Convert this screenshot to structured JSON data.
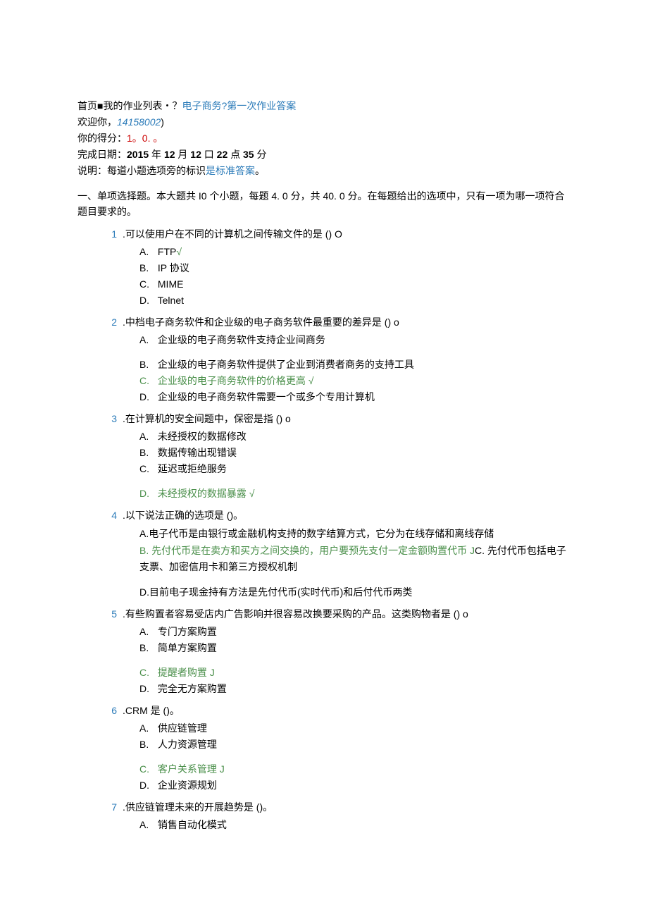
{
  "breadcrumb": {
    "home": "首页",
    "sep1": "■",
    "hw_list": "我的作业列表",
    "sep2": "・？",
    "course": "电子商务",
    "sep3": "?",
    "task": "第一次作业答案"
  },
  "welcome": {
    "prefix": "欢迎你，",
    "id": "14158002",
    "suffix": ")"
  },
  "score": {
    "label": "你的得分：",
    "value": "1。0. 。"
  },
  "date": {
    "label": "完成日期：",
    "year": "2015",
    "y": " 年 ",
    "month": "12",
    "m": " 月 ",
    "day": "12",
    "d": " 口 ",
    "hour": "22",
    "h": " 点 ",
    "min": "35",
    "mm": " 分"
  },
  "note": {
    "prefix": "说明：每道小题选项旁的标识",
    "std": "是标准答案",
    "suffix": "。"
  },
  "section_intro": "一、单项选择题。本大题共 I0 个小题，每题 4. 0 分，共 40. 0 分。在每题给出的选项中，只有一项为哪一项符合题目要求的。",
  "questions": [
    {
      "num": "1",
      "text": ".可以使用户在不同的计算机之间传输文件的是 () O",
      "opts": [
        {
          "letter": "A.",
          "text": "FTP",
          "correct": true,
          "mark": "√"
        },
        {
          "letter": "B.",
          "text": "IP 协议"
        },
        {
          "letter": "C.",
          "text": "MIME"
        },
        {
          "letter": "D.",
          "text": "Telnet"
        }
      ]
    },
    {
      "num": "2",
      "text": ".中档电子商务软件和企业级的电子商务软件最重要的差异是 () o",
      "opts": [
        {
          "letter": "A.",
          "text": "企业级的电子商务软件支持企业间商务",
          "gap_after": true
        },
        {
          "letter": "B.",
          "text": "企业级的电子商务软件提供了企业到消费者商务的支持工具"
        },
        {
          "letter": "C.",
          "text": "企业级的电子商务软件的价格更高 √",
          "green": true
        },
        {
          "letter": "D.",
          "text": "企业级的电子商务软件需要一个或多个专用计算机"
        }
      ]
    },
    {
      "num": "3",
      "text": ".在计算机的安全间题中，保密是指 () o",
      "opts": [
        {
          "letter": "A.",
          "text": "未经授权的数据修改"
        },
        {
          "letter": "B.",
          "text": "数据传输出现错误"
        },
        {
          "letter": "C.",
          "text": "延迟或拒绝服务",
          "gap_after": true
        },
        {
          "letter": "D.",
          "text": "未经授权的数据暴露 √",
          "green": true
        }
      ]
    },
    {
      "num": "4",
      "text": ".以下说法正确的选项是 ()。",
      "inline": true,
      "opts": [
        {
          "letter": "A.",
          "text": "电子代币是由银行或金融机构支持的数字结算方式，它分为在线存储和离线存储"
        },
        {
          "letter": "B.",
          "text": "先付代币是在卖方和买方之间交换的，用户要预先支付一定金额购置代币 J",
          "green": true,
          "followC": true
        },
        {
          "letter": "C.",
          "text": "先付代币包括电子支票、加密信用卡和第三方授权机制",
          "gap_after": true
        },
        {
          "letter": "D.",
          "text": "目前电子现金持有方法是先付代币(实时代币)和后付代币两类"
        }
      ]
    },
    {
      "num": "5",
      "text": ".有些购置者容易受店内广告影响并很容易改换要采购的产品。这类购物者是 () o",
      "opts": [
        {
          "letter": "A.",
          "text": "专门方案购置"
        },
        {
          "letter": "B.",
          "text": "简单方案购置",
          "gap_after": true
        },
        {
          "letter": "C.",
          "text": "提醒者购置 J",
          "green": true
        },
        {
          "letter": "D.",
          "text": "完全无方案购置"
        }
      ]
    },
    {
      "num": "6",
      "text": ".CRM 是 ()。",
      "opts": [
        {
          "letter": "A.",
          "text": "供应链管理"
        },
        {
          "letter": "B.",
          "text": "人力资源管理",
          "gap_after": true
        },
        {
          "letter": "C.",
          "text": "客户关系管理 J",
          "green": true
        },
        {
          "letter": "D.",
          "text": "企业资源规划"
        }
      ]
    },
    {
      "num": "7",
      "text": ".供应链管理未来的开展趋势是 ()。",
      "opts": [
        {
          "letter": "A.",
          "text": "销售自动化模式"
        }
      ]
    }
  ]
}
